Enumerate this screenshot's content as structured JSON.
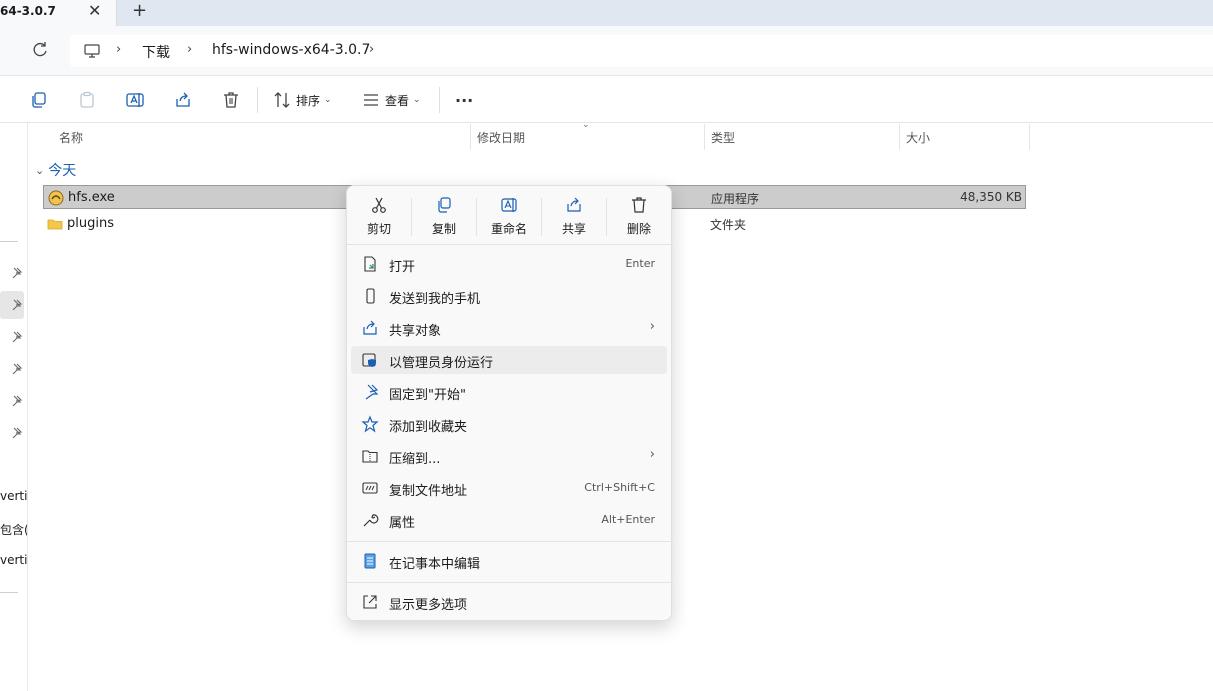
{
  "tab": {
    "title": "64-3.0.7",
    "close": "✕",
    "new": "+"
  },
  "breadcrumb": {
    "sep": "›",
    "items": [
      "下载",
      "hfs-windows-x64-3.0.7"
    ]
  },
  "toolbar": {
    "sort_label": "排序",
    "view_label": "查看",
    "more": "···",
    "caret": "⌄"
  },
  "columns": {
    "name": "名称",
    "modified": "修改日期",
    "type": "类型",
    "size": "大小"
  },
  "group": {
    "label": "今天",
    "chevron": "⌄"
  },
  "files": [
    {
      "name": "hfs.exe",
      "type": "应用程序",
      "size": "48,350 KB",
      "icon": "exe-app-icon"
    },
    {
      "name": "plugins",
      "type": "文件夹",
      "size": "",
      "icon": "folder-icon"
    }
  ],
  "leftnav": {
    "texts": [
      "vertis",
      "包含(",
      "vertis"
    ]
  },
  "context_menu": {
    "quick_actions": [
      "剪切",
      "复制",
      "重命名",
      "共享",
      "删除"
    ],
    "items": [
      {
        "label": "打开",
        "shortcut": "Enter"
      },
      {
        "label": "发送到我的手机",
        "shortcut": ""
      },
      {
        "label": "共享对象",
        "shortcut": ""
      },
      {
        "label": "以管理员身份运行",
        "shortcut": ""
      },
      {
        "label": "固定到\"开始\"",
        "shortcut": ""
      },
      {
        "label": "添加到收藏夹",
        "shortcut": ""
      },
      {
        "label": "压缩到...",
        "shortcut": ""
      },
      {
        "label": "复制文件地址",
        "shortcut": "Ctrl+Shift+C"
      },
      {
        "label": "属性",
        "shortcut": "Alt+Enter"
      },
      {
        "label": "在记事本中编辑",
        "shortcut": ""
      },
      {
        "label": "显示更多选项",
        "shortcut": ""
      }
    ],
    "submenu_arrow": "›"
  },
  "colors": {
    "accent": "#1a5fb4",
    "selected_row": "#cccccc",
    "menu_bg": "#f9f9f9"
  }
}
